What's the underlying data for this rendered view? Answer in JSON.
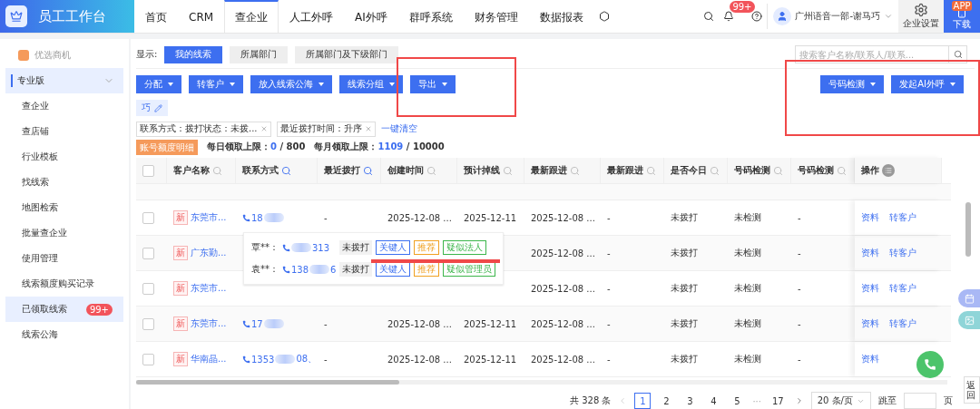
{
  "app": {
    "title": "员工工作台"
  },
  "nav": [
    {
      "label": "首页",
      "selected": false
    },
    {
      "label": "CRM",
      "selected": false
    },
    {
      "label": "查企业",
      "selected": true
    },
    {
      "label": "人工外呼",
      "selected": false
    },
    {
      "label": "AI外呼",
      "selected": false
    },
    {
      "label": "群呼系统",
      "selected": false
    },
    {
      "label": "财务管理",
      "selected": false
    },
    {
      "label": "数据报表",
      "selected": false
    }
  ],
  "notifications": {
    "badge": "99+"
  },
  "user": {
    "name": "广州语音一部-谢马巧"
  },
  "settings_button": {
    "label": "企业设置"
  },
  "app_download": {
    "badge": "APP",
    "label": "下载"
  },
  "sidebar": {
    "promo": "优选商机",
    "section": {
      "label": "专业版",
      "expanded": true
    },
    "items": [
      {
        "label": "查企业",
        "selected": false
      },
      {
        "label": "查店铺",
        "selected": false
      },
      {
        "label": "行业模板",
        "selected": false
      },
      {
        "label": "找线索",
        "selected": false
      },
      {
        "label": "地图检索",
        "selected": false
      },
      {
        "label": "批量查企业",
        "selected": false
      },
      {
        "label": "使用管理",
        "selected": false
      },
      {
        "label": "线索额度购买记录",
        "selected": false
      },
      {
        "label": "已领取线索",
        "selected": true,
        "badge": "99+"
      },
      {
        "label": "线索公海",
        "selected": false
      }
    ]
  },
  "display": {
    "label": "显示:",
    "options": [
      {
        "label": "我的线索",
        "selected": true
      },
      {
        "label": "所属部门",
        "selected": false
      },
      {
        "label": "所属部门及下级部门",
        "selected": false
      }
    ]
  },
  "search": {
    "placeholder": "搜索客户名称/联系人/联系..."
  },
  "actions_left": [
    "分配",
    "转客户",
    "放入线索公海",
    "线索分组",
    "导出"
  ],
  "actions_right": [
    "号码检测",
    "发起AI外呼"
  ],
  "shortcut": "巧",
  "filters": [
    {
      "label": "联系方式：拨打状态：未拨..."
    },
    {
      "label": "最近拨打时间：升序"
    }
  ],
  "clear_filters": "一键清空",
  "quota": {
    "badge": "账号额度明细",
    "daily_label": "每日领取上限：",
    "daily_used": "0",
    "daily_total": "/  800",
    "monthly_label": "每月领取上限：",
    "monthly_used": "1109",
    "monthly_total": "/  10000"
  },
  "table": {
    "all_checked": false,
    "columns": [
      {
        "label": "客户名称",
        "filtered": false
      },
      {
        "label": "联系方式",
        "filtered": true
      },
      {
        "label": "最近拨打",
        "filtered": true
      },
      {
        "label": "创建时间",
        "filtered": false
      },
      {
        "label": "预计掉线",
        "filtered": false
      },
      {
        "label": "最新跟进",
        "filtered": false
      },
      {
        "label": "最新跟进",
        "filtered": false
      },
      {
        "label": "是否今日",
        "filtered": false
      },
      {
        "label": "号码检测",
        "filtered": false
      },
      {
        "label": "号码检测",
        "filtered": false
      }
    ],
    "actions_column": "操作",
    "rows": [
      {
        "checked": false,
        "tag": "新",
        "name": "东莞市...",
        "phone": {
          "prefix": "18"
        },
        "last_call": "-",
        "created": "2025-12-08 ...",
        "expected": "2025-12-11",
        "follow_time": "2025-12-08 ...",
        "follow_note": "-",
        "called_today": "未拨打",
        "check_time": "未检测",
        "check_result": "-",
        "actions": [
          "资料",
          "转客户"
        ]
      },
      {
        "checked": false,
        "tag": "新",
        "name": "广东勤...",
        "follow_time": "2025-12-08 ...",
        "follow_note": "-",
        "called_today": "未拨打",
        "check_time": "未检测",
        "check_result": "-",
        "actions": [
          "资料",
          "转客户"
        ]
      },
      {
        "checked": false,
        "tag": "新",
        "name": "东莞市...",
        "follow_time": "2025-12-08 ...",
        "follow_note": "-",
        "called_today": "未拨打",
        "check_time": "未检测",
        "check_result": "-",
        "actions": [
          "资料",
          "转客户"
        ]
      },
      {
        "checked": false,
        "tag": "新",
        "name": "东莞市...",
        "phone": {
          "prefix": "17"
        },
        "last_call": "-",
        "created": "2025-12-08 ...",
        "expected": "2025-12-11",
        "follow_time": "2025-12-08 ...",
        "follow_note": "-",
        "called_today": "未拨打",
        "check_time": "未检测",
        "check_result": "-",
        "actions": [
          "资料",
          "转客户"
        ]
      },
      {
        "checked": false,
        "tag": "新",
        "name": "华南晶...",
        "phone": {
          "prefix": "1353",
          "suffix": "08、"
        },
        "last_call": "-",
        "created": "2025-12-08 ...",
        "expected": "2025-12-11",
        "follow_time": "2025-12-08 ...",
        "follow_note": "-",
        "called_today": "未拨打",
        "check_time": "未检测",
        "check_result": "-",
        "actions": [
          "资料"
        ]
      }
    ]
  },
  "contacts_popover": [
    {
      "name": "覃**：",
      "phone": {
        "suffix": "313"
      },
      "status": "未拨打",
      "tags": [
        {
          "label": "关键人",
          "color": "#3a6ff0"
        },
        {
          "label": "推荐",
          "color": "#f0a020"
        },
        {
          "label": "疑似法人",
          "color": "#3bb54a"
        }
      ]
    },
    {
      "name": "袁**：",
      "phone": {
        "prefix": "138",
        "suffix": "6"
      },
      "status": "未拨打",
      "tags": [
        {
          "label": "关键人",
          "color": "#3a6ff0"
        },
        {
          "label": "推荐",
          "color": "#f0a020"
        },
        {
          "label": "疑似管理员",
          "color": "#3bb54a"
        }
      ]
    }
  ],
  "pagination": {
    "total": "共 328 条",
    "pages": [
      {
        "label": "1",
        "selected": true,
        "kind": "page"
      },
      {
        "label": "2",
        "selected": false,
        "kind": "page"
      },
      {
        "label": "3",
        "selected": false,
        "kind": "page"
      },
      {
        "label": "4",
        "selected": false,
        "kind": "page"
      },
      {
        "label": "5",
        "selected": false,
        "kind": "page"
      },
      {
        "label": "···",
        "kind": "ellipsis"
      },
      {
        "label": "17",
        "selected": false,
        "kind": "page"
      }
    ],
    "page_size": "20 条/页",
    "jump_label": "跳至",
    "page_suffix": "页"
  },
  "back_to_top": "返回"
}
